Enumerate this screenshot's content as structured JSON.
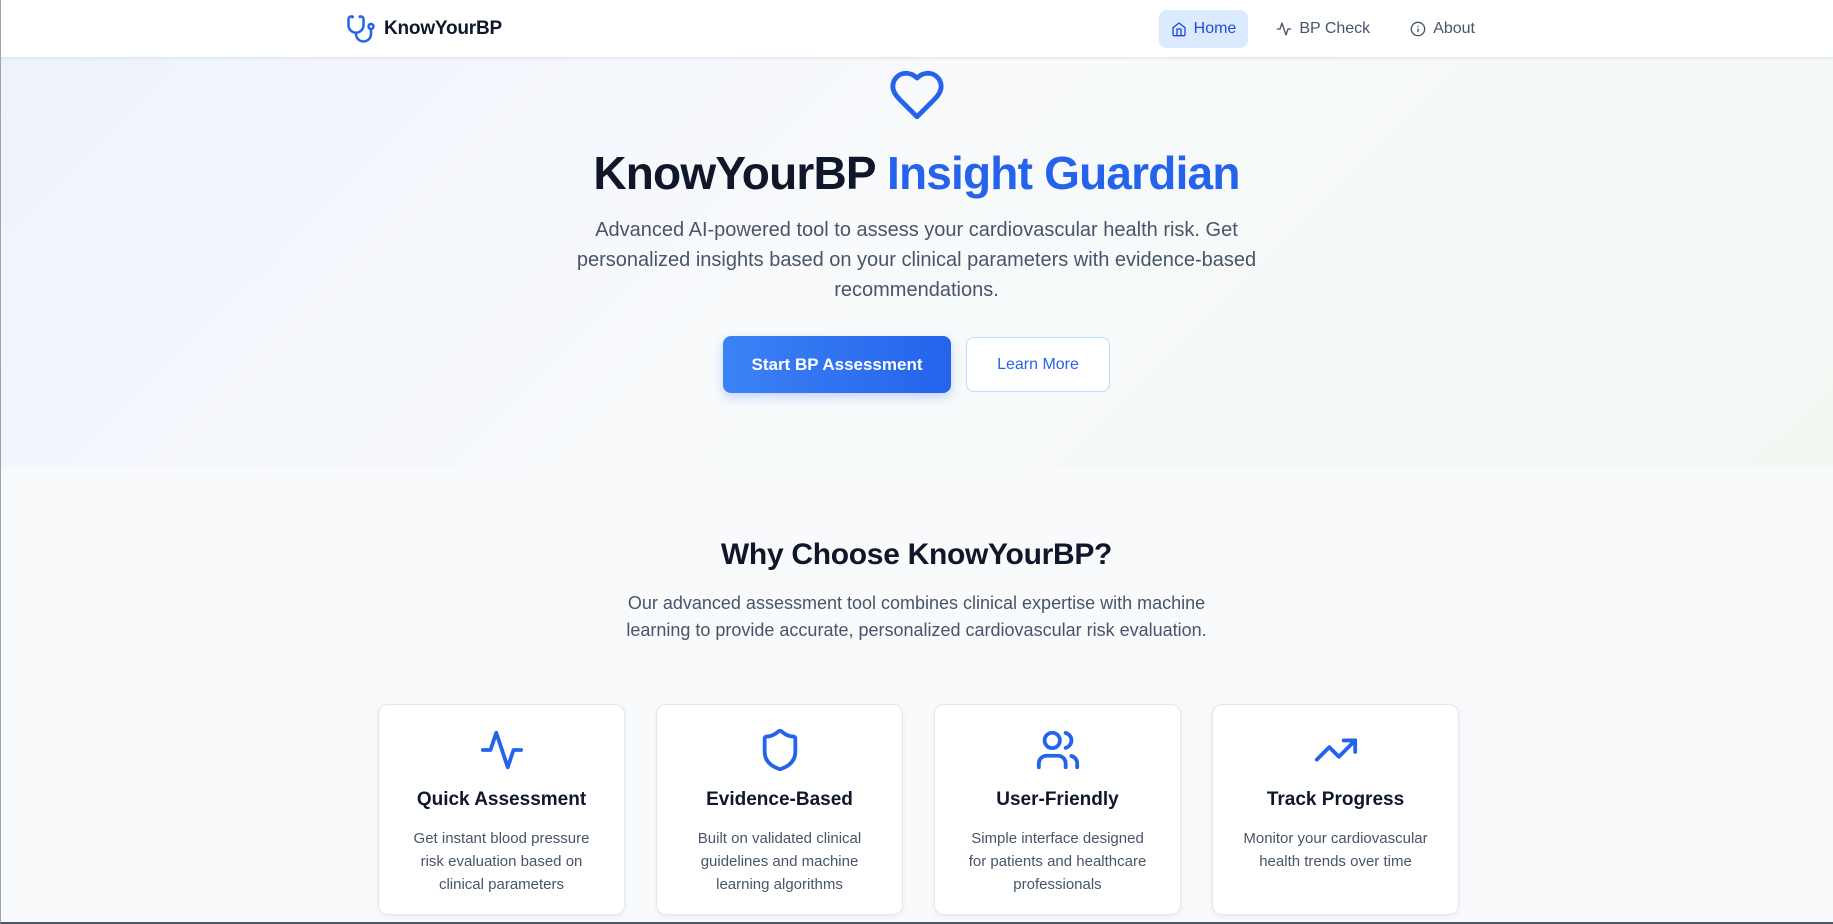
{
  "nav": {
    "brand": "KnowYourBP",
    "links": [
      {
        "label": "Home",
        "icon": "home-icon",
        "active": true
      },
      {
        "label": "BP Check",
        "icon": "activity-icon",
        "active": false
      },
      {
        "label": "About",
        "icon": "info-icon",
        "active": false
      }
    ]
  },
  "hero": {
    "icon": "heart-icon",
    "title_main": "KnowYourBP",
    "title_accent": "Insight Guardian",
    "subtitle": "Advanced AI-powered tool to assess your cardiovascular health risk. Get personalized insights based on your clinical parameters with evidence-based recommendations.",
    "primary_button": "Start BP Assessment",
    "secondary_button": "Learn More"
  },
  "features": {
    "title": "Why Choose KnowYourBP?",
    "subtitle": "Our advanced assessment tool combines clinical expertise with machine learning to provide accurate, personalized cardiovascular risk evaluation.",
    "cards": [
      {
        "icon": "activity-icon",
        "title": "Quick Assessment",
        "desc": "Get instant blood pressure risk evaluation based on clinical parameters"
      },
      {
        "icon": "shield-icon",
        "title": "Evidence-Based",
        "desc": "Built on validated clinical guidelines and machine learning algorithms"
      },
      {
        "icon": "users-icon",
        "title": "User-Friendly",
        "desc": "Simple interface designed for patients and healthcare professionals"
      },
      {
        "icon": "trending-up-icon",
        "title": "Track Progress",
        "desc": "Monitor your cardiovascular health trends over time"
      }
    ]
  },
  "colors": {
    "accent": "#2563eb",
    "accent_light": "#dbeafe",
    "text_dark": "#0f172a",
    "text_muted": "#475569",
    "background": "#f8fafc"
  }
}
